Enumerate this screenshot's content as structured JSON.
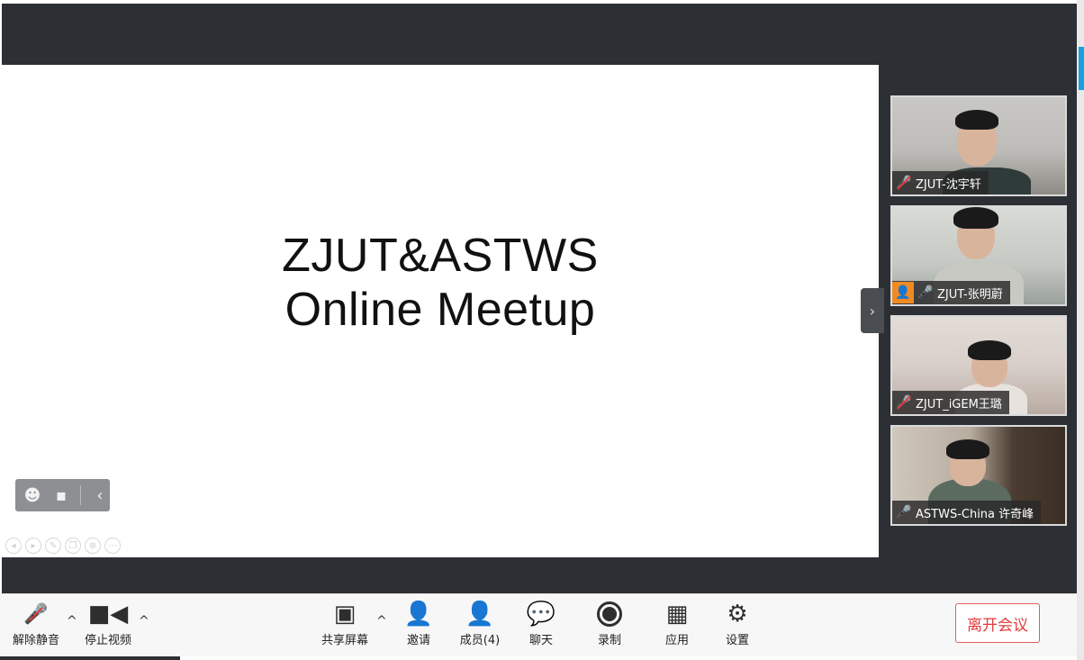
{
  "slide": {
    "line1": "ZJUT&ASTWS",
    "line2": "Online Meetup"
  },
  "reaction_bar": {
    "emoji_icon": "smile-icon",
    "chat_icon": "chat-bubble-icon",
    "collapse_icon": "chevron-left-icon"
  },
  "participants": [
    {
      "name": "ZJUT-沈宇轩",
      "mic": "muted"
    },
    {
      "name": "ZJUT-张明蔚",
      "mic": "on",
      "avatar": true
    },
    {
      "name": "ZJUT_iGEM王璐",
      "mic": "muted"
    },
    {
      "name": "ASTWS-China 许奇峰",
      "mic": "on"
    }
  ],
  "toolbar": {
    "unmute": "解除静音",
    "stop_video": "停止视频",
    "share_screen": "共享屏幕",
    "invite": "邀请",
    "members": "成员(4)",
    "chat": "聊天",
    "record": "录制",
    "apps": "应用",
    "settings": "设置",
    "leave": "离开会议"
  },
  "colors": {
    "dark_bg": "#2c2f34",
    "leave_red": "#e23b3b",
    "avatar_orange": "#f08a24"
  }
}
